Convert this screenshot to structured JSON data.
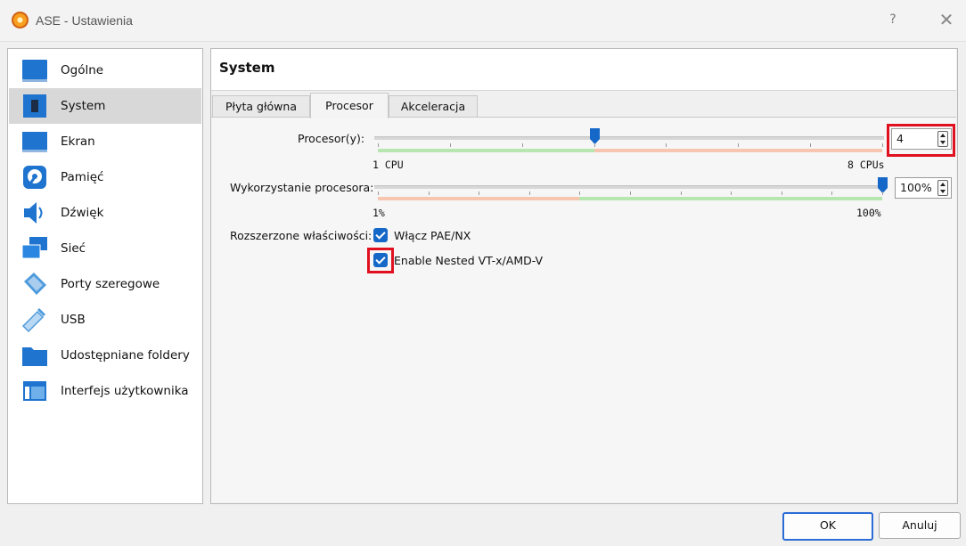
{
  "window": {
    "title": "ASE - Ustawienia",
    "help_label": "?",
    "close_label": "✕"
  },
  "sidebar": {
    "items": [
      {
        "label": "Ogólne",
        "icon": "monitor-icon"
      },
      {
        "label": "System",
        "icon": "chip-icon",
        "selected": true
      },
      {
        "label": "Ekran",
        "icon": "display-icon"
      },
      {
        "label": "Pamięć",
        "icon": "disk-icon"
      },
      {
        "label": "Dźwięk",
        "icon": "speaker-icon"
      },
      {
        "label": "Sieć",
        "icon": "network-icon"
      },
      {
        "label": "Porty szeregowe",
        "icon": "serial-port-icon"
      },
      {
        "label": "USB",
        "icon": "usb-icon"
      },
      {
        "label": "Udostępniane foldery",
        "icon": "folder-icon"
      },
      {
        "label": "Interfejs użytkownika",
        "icon": "ui-window-icon"
      }
    ]
  },
  "panel": {
    "title": "System",
    "tabs": [
      {
        "label": "Płyta główna"
      },
      {
        "label": "Procesor",
        "active": true
      },
      {
        "label": "Akceleracja"
      }
    ]
  },
  "processor": {
    "cpus_label": "Procesor(y):",
    "cpus_value": "4",
    "cpus_level": 0.4286,
    "cpus_min_label": "1 CPU",
    "cpus_max_label": "8 CPUs",
    "cap_label": "Wykorzystanie procesora:",
    "cap_value": "100%",
    "cap_level": 1.0,
    "cap_min_label": "1%",
    "cap_max_label": "100%",
    "ext_label": "Rozszerzone właściwości:",
    "pae_label": "Włącz PAE/NX",
    "pae_checked": true,
    "nested_label": "Enable Nested VT-x/AMD-V",
    "nested_checked": true
  },
  "colors": {
    "good_zone": "#b8e6b0",
    "bad_zone": "#f7c6b0",
    "accent": "#1668c8",
    "highlight": "#e01020"
  },
  "footer": {
    "ok_label": "OK",
    "cancel_label": "Anuluj"
  }
}
